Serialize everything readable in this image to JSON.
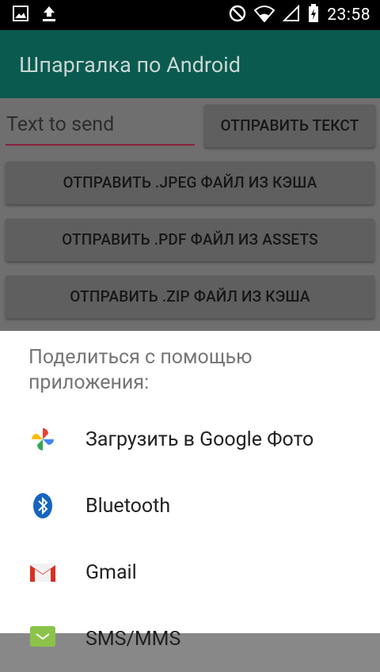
{
  "status_bar": {
    "left_icons": [
      "image-icon",
      "download-icon"
    ],
    "right_icons": [
      "do-not-disturb-icon",
      "wifi-icon",
      "signal-icon",
      "battery-charging-icon"
    ],
    "time": "23:58"
  },
  "app_bar": {
    "title": "Шпаргалка по Android"
  },
  "main": {
    "text_field_value": "Text to send",
    "send_text_button": "ОТПРАВИТЬ ТЕКСТ",
    "buttons": [
      "ОТПРАВИТЬ .JPEG ФАЙЛ ИЗ КЭША",
      "ОТПРАВИТЬ .PDF ФАЙЛ ИЗ ASSETS",
      "ОТПРАВИТЬ .ZIP ФАЙЛ ИЗ КЭША"
    ]
  },
  "share_sheet": {
    "title": "Поделиться с помощью приложения:",
    "items": [
      {
        "label": "Загрузить в Google Фото",
        "icon": "google-photos-icon"
      },
      {
        "label": "Bluetooth",
        "icon": "bluetooth-icon"
      },
      {
        "label": "Gmail",
        "icon": "gmail-icon"
      },
      {
        "label": "SMS/MMS",
        "icon": "sms-icon"
      }
    ]
  },
  "colors": {
    "status_bar": "#000000",
    "app_bar": "#0a5a4f",
    "accent_underline": "#8a1f3d",
    "sheet_background": "#ffffff"
  }
}
